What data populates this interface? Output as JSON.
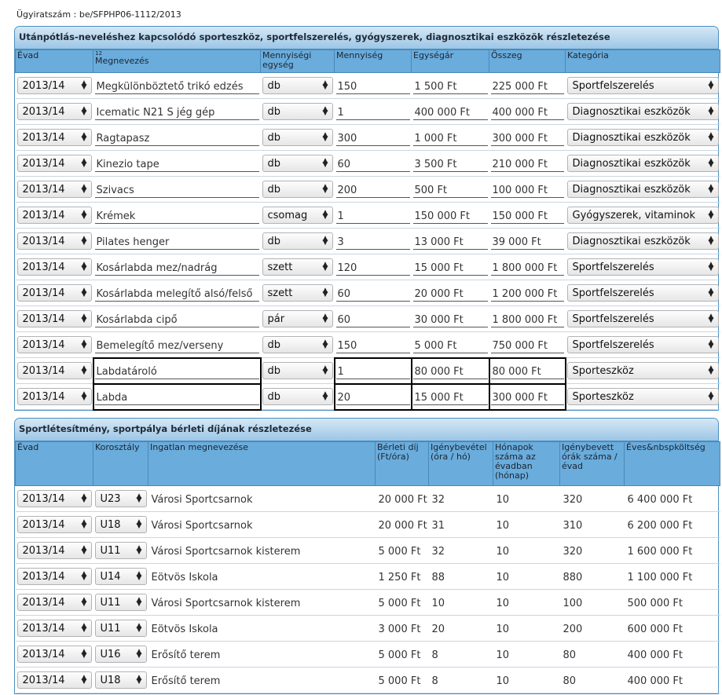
{
  "case_number": "Ügyiratszám : be/SFPHP06-1112/2013",
  "section1": {
    "title": "Utánpótlás-neveléshez kapcsolódó sporteszköz, sportfelszerelés, gyógyszerek, diagnosztikai eszközök részletezése",
    "headers": {
      "season": "Évad",
      "name_sup": "12",
      "name": "Megnevezés",
      "unit": "Mennyiségi egység",
      "qty": "Mennyiség",
      "unit_price": "Egységár",
      "total": "Összeg",
      "category": "Kategória"
    },
    "rows": [
      {
        "season": "2013/14",
        "name": "Megkülönböztető trikó edzés",
        "unit": "db",
        "qty": "150",
        "unit_price": "1 500 Ft",
        "total": "225 000  Ft",
        "category": "Sportfelszerelés"
      },
      {
        "season": "2013/14",
        "name": "Icematic N21 S jég gép",
        "unit": "db",
        "qty": "1",
        "unit_price": "400 000 Ft",
        "total": "400 000  Ft",
        "category": "Diagnosztikai eszközök"
      },
      {
        "season": "2013/14",
        "name": "Ragtapasz",
        "unit": "db",
        "qty": "300",
        "unit_price": "1 000 Ft",
        "total": "300 000  Ft",
        "category": "Diagnosztikai eszközök"
      },
      {
        "season": "2013/14",
        "name": "Kinezio tape",
        "unit": "db",
        "qty": "60",
        "unit_price": "3 500 Ft",
        "total": "210 000  Ft",
        "category": "Diagnosztikai eszközök"
      },
      {
        "season": "2013/14",
        "name": "Szivacs",
        "unit": "db",
        "qty": "200",
        "unit_price": "500 Ft",
        "total": "100 000  Ft",
        "category": "Diagnosztikai eszközök"
      },
      {
        "season": "2013/14",
        "name": "Krémek",
        "unit": "csomag",
        "qty": "1",
        "unit_price": "150 000 Ft",
        "total": "150 000  Ft",
        "category": "Gyógyszerek, vitaminok"
      },
      {
        "season": "2013/14",
        "name": "Pilates henger",
        "unit": "db",
        "qty": "3",
        "unit_price": "13 000 Ft",
        "total": "39 000  Ft",
        "category": "Diagnosztikai eszközök"
      },
      {
        "season": "2013/14",
        "name": "Kosárlabda mez/nadrág",
        "unit": "szett",
        "qty": "120",
        "unit_price": "15 000 Ft",
        "total": "1 800 000  Ft",
        "category": "Sportfelszerelés"
      },
      {
        "season": "2013/14",
        "name": "Kosárlabda melegítő alsó/felső",
        "unit": "szett",
        "qty": "60",
        "unit_price": "20 000 Ft",
        "total": "1 200 000  Ft",
        "category": "Sportfelszerelés"
      },
      {
        "season": "2013/14",
        "name": "Kosárlabda cipő",
        "unit": "pár",
        "qty": "60",
        "unit_price": "30 000 Ft",
        "total": "1 800 000  Ft",
        "category": "Sportfelszerelés"
      },
      {
        "season": "2013/14",
        "name": "Bemelegítő mez/verseny",
        "unit": "db",
        "qty": "150",
        "unit_price": "5 000 Ft",
        "total": "750 000  Ft",
        "category": "Sportfelszerelés"
      },
      {
        "season": "2013/14",
        "name": "Labdatároló",
        "unit": "db",
        "qty": "1",
        "unit_price": "80 000 Ft",
        "total": "80 000  Ft",
        "category": "Sporteszköz"
      },
      {
        "season": "2013/14",
        "name": "Labda",
        "unit": "db",
        "qty": "20",
        "unit_price": "15 000 Ft",
        "total": "300 000  Ft",
        "category": "Sporteszköz"
      }
    ]
  },
  "section2": {
    "title": "Sportlétesítmény, sportpálya bérleti díjának részletezése",
    "headers": {
      "season": "Évad",
      "age": "Korosztály",
      "property": "Ingatlan megnevezése",
      "rent": "Bérleti díj (Ft/óra)",
      "usage": "Igénybevétel (óra / hó)",
      "months": "Hónapok száma az évadban (hónap)",
      "hours": "Igénybevett órák száma / évad",
      "annual": "Éves&nbspköltség"
    },
    "rows": [
      {
        "season": "2013/14",
        "age": "U23",
        "property": "Városi Sportcsarnok",
        "rent": "20 000 Ft",
        "usage": "32",
        "months": "10",
        "hours": "320",
        "annual": "6 400 000  Ft"
      },
      {
        "season": "2013/14",
        "age": "U18",
        "property": "Városi Sportcsarnok",
        "rent": "20 000 Ft",
        "usage": "31",
        "months": "10",
        "hours": "310",
        "annual": "6 200 000  Ft"
      },
      {
        "season": "2013/14",
        "age": "U11",
        "property": "Városi Sportcsarnok kisterem",
        "rent": "5 000 Ft",
        "usage": "32",
        "months": "10",
        "hours": "320",
        "annual": "1 600 000  Ft"
      },
      {
        "season": "2013/14",
        "age": "U14",
        "property": "Eötvös Iskola",
        "rent": "1 250 Ft",
        "usage": "88",
        "months": "10",
        "hours": "880",
        "annual": "1 100 000  Ft"
      },
      {
        "season": "2013/14",
        "age": "U11",
        "property": "Városi Sportcsarnok kisterem",
        "rent": "5 000 Ft",
        "usage": "10",
        "months": "10",
        "hours": "100",
        "annual": "500 000  Ft"
      },
      {
        "season": "2013/14",
        "age": "U11",
        "property": "Eötvös Iskola",
        "rent": "3 000 Ft",
        "usage": "20",
        "months": "10",
        "hours": "200",
        "annual": "600 000  Ft"
      },
      {
        "season": "2013/14",
        "age": "U16",
        "property": "Erősítő terem",
        "rent": "5 000 Ft",
        "usage": "8",
        "months": "10",
        "hours": "80",
        "annual": "400 000  Ft"
      },
      {
        "season": "2013/14",
        "age": "U18",
        "property": "Erősítő terem",
        "rent": "5 000 Ft",
        "usage": "8",
        "months": "10",
        "hours": "80",
        "annual": "400 000  Ft"
      }
    ]
  }
}
